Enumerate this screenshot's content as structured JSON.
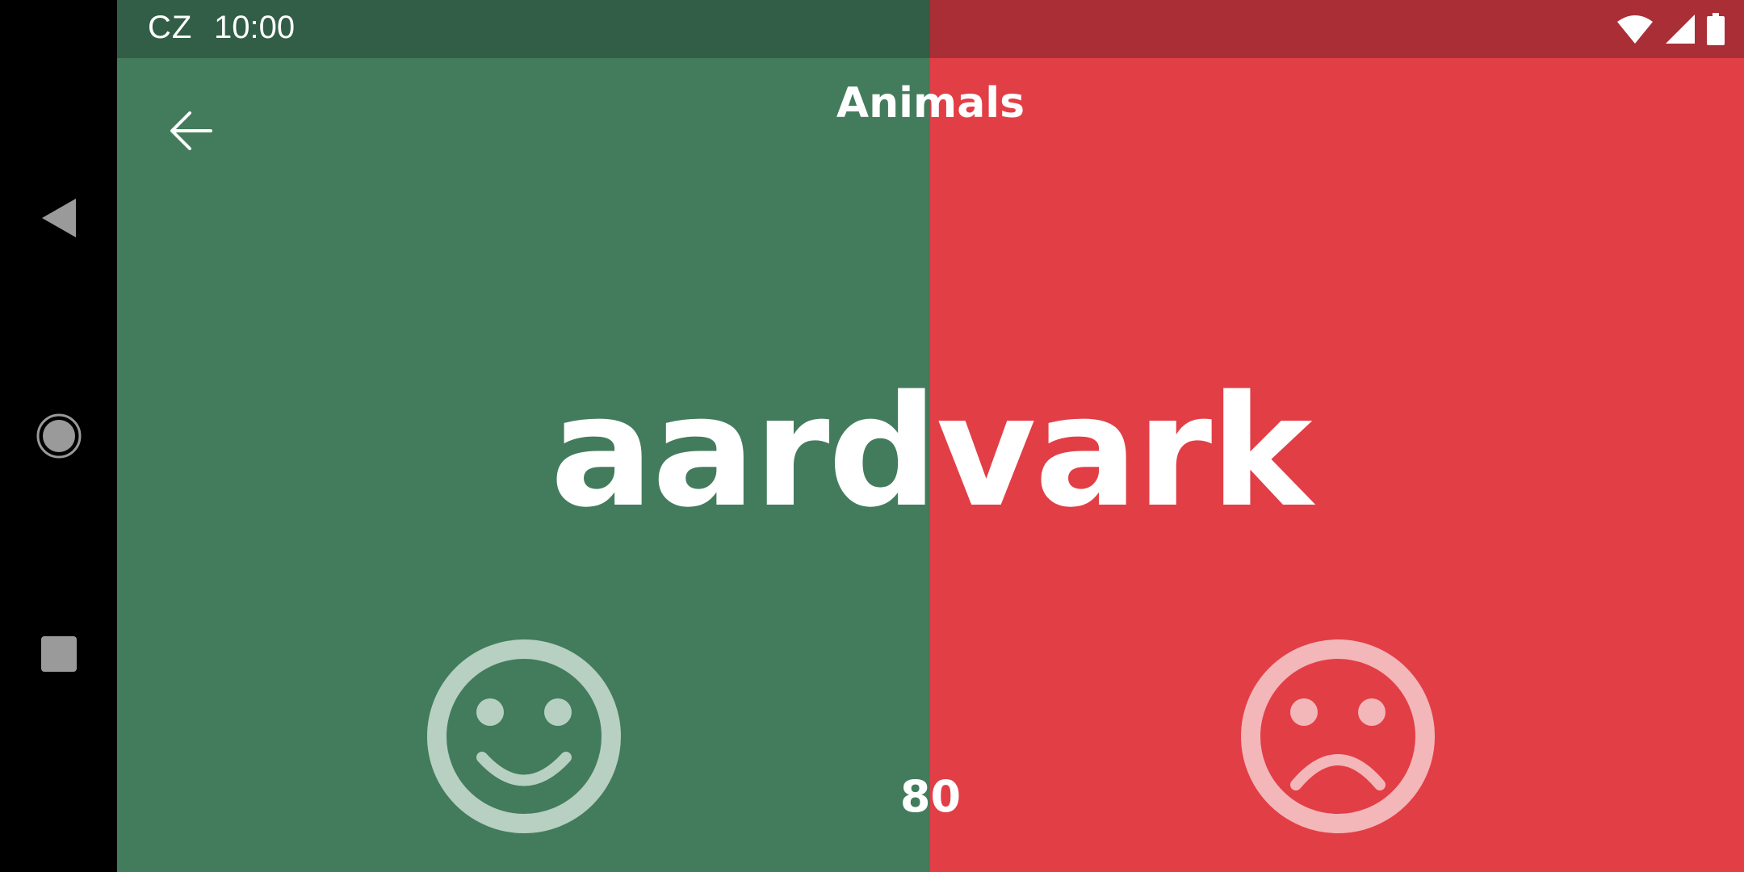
{
  "status_bar": {
    "carrier": "CZ",
    "time": "10:00",
    "icons": [
      "wifi-icon",
      "signal-icon",
      "battery-icon"
    ]
  },
  "navigation_bar": {
    "buttons": [
      "back-triangle-icon",
      "home-circle-icon",
      "recents-square-icon"
    ]
  },
  "header": {
    "back_icon": "arrow-left-icon",
    "category": "Animals"
  },
  "game": {
    "word": "aardvark",
    "timer": "80",
    "correct_icon": "smiley-face-icon",
    "pass_icon": "sad-face-icon"
  },
  "colors": {
    "correct_side": "#437c5c",
    "correct_statusbar": "#325d46",
    "pass_side": "#e23e46",
    "pass_statusbar": "#aa2e35",
    "nav_bg": "#000000",
    "text": "#ffffff"
  }
}
